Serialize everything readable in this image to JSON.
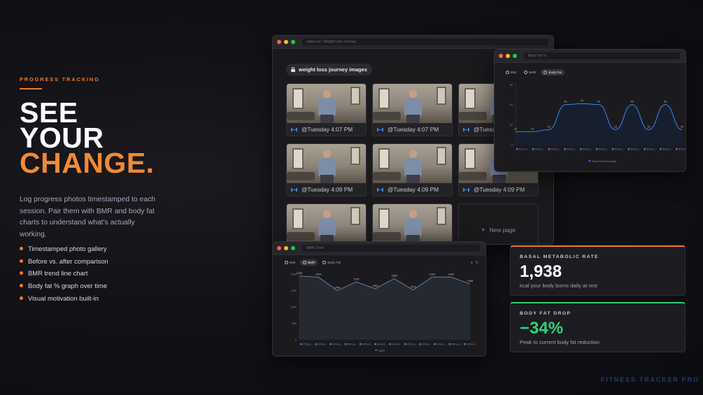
{
  "hero": {
    "eyebrow": "PROGRESS TRACKING",
    "headline_1": "SEE",
    "headline_2": "YOUR",
    "headline_3": "CHANGE.",
    "description": "Log progress photos timestamped to each session. Pair them with BMR and body fat charts to understand what's actually working.",
    "bullets": [
      "Timestamped photo gallery",
      "Before vs. after comparison",
      "BMR trend line chart",
      "Body fat % graph over time",
      "Visual motivation built-in"
    ]
  },
  "photos_window": {
    "url": "notion.so / Weight Loss Journey",
    "gallery_title": "weight loss journey images",
    "cards": [
      {
        "caption": "@Tuesday 4:07 PM"
      },
      {
        "caption": "@Tuesday 4:07 PM"
      },
      {
        "caption": "@Tuesday 4:07 PM"
      },
      {
        "caption": "@Tuesday 4:09 PM"
      },
      {
        "caption": "@Tuesday 4:09 PM"
      },
      {
        "caption": "@Tuesday 4:09 PM"
      },
      {
        "caption": ""
      },
      {
        "caption": ""
      }
    ],
    "new_page_label": "New page",
    "icons": {
      "lock": "lock-icon",
      "card": "dumbbell-icon",
      "new": "plus-icon"
    }
  },
  "bodyfat_window": {
    "url": "Body Fat %",
    "tabs": [
      "BMI",
      "BMR",
      "Body Fat"
    ],
    "active_tab": "Body Fat",
    "legend": "Body Fat Percentage",
    "y_ticks": [
      "60",
      "40",
      "20",
      "0"
    ],
    "x_labels": [
      "@Last C...",
      "@Week...",
      "@Week...",
      "@Week...",
      "@Week...",
      "@Week...",
      "@Week...",
      "@Week...",
      "@Week...",
      "@Week...",
      "@Week..."
    ],
    "chart_data": {
      "type": "area",
      "values": [
        13,
        13,
        15,
        40,
        41,
        40,
        15,
        40,
        15,
        40,
        15
      ],
      "labels": [
        "13",
        "13",
        "15",
        "40",
        "41",
        "40",
        "15",
        "40",
        "15",
        "40",
        "15"
      ],
      "ylim": [
        0,
        60
      ],
      "color": "#3b82f6"
    }
  },
  "bmr_window": {
    "url": "BMR Chart",
    "tabs": [
      "BMI",
      "BMR",
      "Body Fat"
    ],
    "active_tab": "BMR",
    "legend": "BMR",
    "y_ticks": [
      "2000",
      "1500",
      "1000",
      "500",
      "0"
    ],
    "x_labels": [
      "@Weig...",
      "@Week...",
      "@Week...",
      "@Week...",
      "@Week...",
      "@Week...",
      "@Week...",
      "@Week...",
      "@Week...",
      "@Week...",
      "@Week...",
      "@Week..."
    ],
    "chart_data": {
      "type": "area",
      "values": [
        1938,
        1906,
        1498,
        1760,
        1554,
        1860,
        1516,
        1909,
        1909,
        1698
      ],
      "labels": [
        "1938",
        "1906",
        "1498",
        "1760",
        "1554",
        "1860",
        "1516",
        "1909",
        "1909",
        "1698"
      ],
      "ylim": [
        0,
        2000
      ],
      "color": "#6b7a94"
    }
  },
  "stats": {
    "bmr_label": "BASAL METABOLIC RATE",
    "bmr_value": "1,938",
    "bmr_sub": "kcal your body burns daily at rest",
    "bf_label": "BODY FAT DROP",
    "bf_value": "−34%",
    "bf_sub": "Peak to current body fat reduction",
    "bmr_accent": "#f07a2c",
    "bf_accent": "#2ecf6e"
  },
  "brand": "FITNESS TRACKER PRO"
}
